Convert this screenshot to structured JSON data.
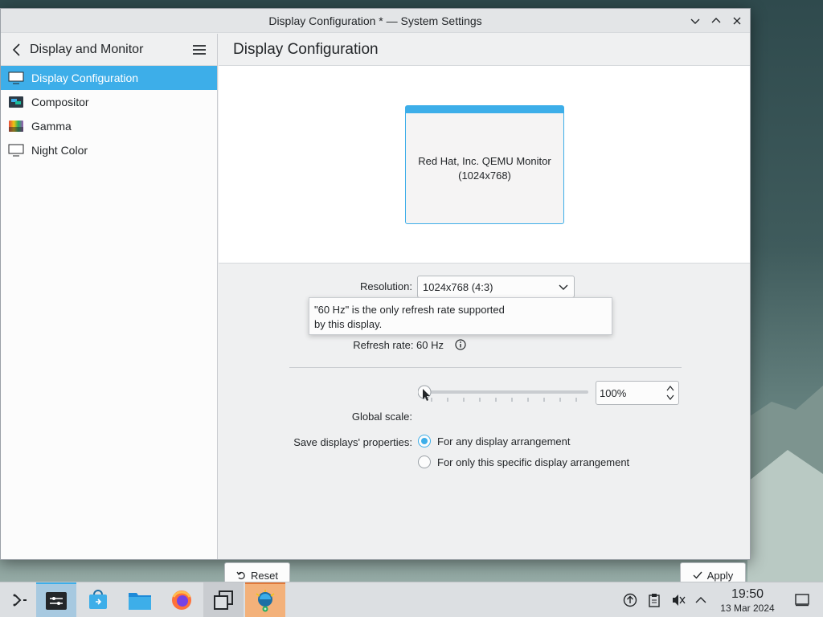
{
  "window": {
    "title": "Display Configuration * — System Settings"
  },
  "sidebar": {
    "heading": "Display and Monitor",
    "items": [
      {
        "label": "Display Configuration",
        "icon": "monitor-icon",
        "active": true
      },
      {
        "label": "Compositor",
        "icon": "compositor-icon",
        "active": false
      },
      {
        "label": "Gamma",
        "icon": "gamma-icon",
        "active": false
      },
      {
        "label": "Night Color",
        "icon": "night-color-icon",
        "active": false
      }
    ]
  },
  "main": {
    "title": "Display Configuration",
    "monitor": {
      "name": "Red Hat, Inc. QEMU Monitor",
      "resolution": "(1024x768)"
    },
    "form": {
      "resolution_label": "Resolution:",
      "resolution_value": "1024x768 (4:3)",
      "tooltip_line1": "\"60 Hz\" is the only refresh rate supported",
      "tooltip_line2": "by this display.",
      "refresh_rate": "Refresh rate: 60 Hz",
      "global_scale_label": "Global scale:",
      "global_scale_value": "100%",
      "save_label": "Save displays' properties:",
      "radio_options": [
        {
          "label": "For any display arrangement",
          "selected": true
        },
        {
          "label": "For only this specific display arrangement",
          "selected": false
        }
      ]
    },
    "buttons": {
      "reset": "Reset",
      "apply": "Apply"
    }
  },
  "taskbar": {
    "time": "19:50",
    "date": "13 Mar 2024"
  },
  "colors": {
    "accent": "#3daee9",
    "window_bg": "#eff0f1",
    "sidebar_bg": "#fcfcfc"
  }
}
